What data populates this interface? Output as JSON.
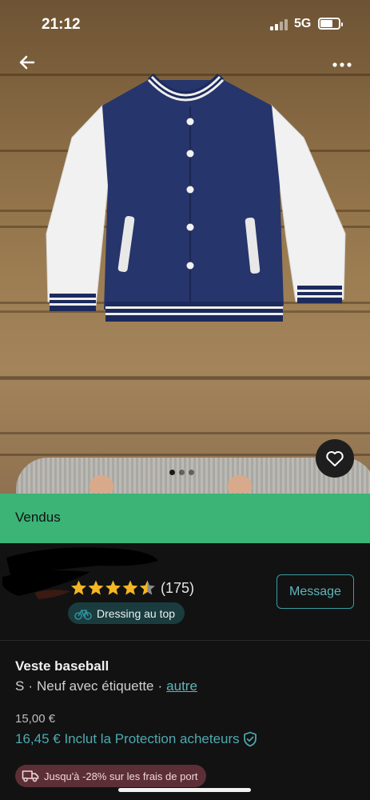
{
  "status_bar": {
    "time": "21:12",
    "network": "5G"
  },
  "listing": {
    "status_label": "Vendus",
    "photo_count": 3,
    "active_photo": 1
  },
  "seller": {
    "rating": 4.5,
    "rating_count": "(175)",
    "badge_label": "Dressing au top",
    "message_label": "Message"
  },
  "item": {
    "title": "Veste baseball",
    "size": "S",
    "separator": "·",
    "condition": "Neuf avec étiquette",
    "brand_link": "autre",
    "price": "15,00 €",
    "price_with_protection": "16,45 € Inclut la Protection acheteurs",
    "shipping_promo": "Jusqu'à -28% sur les frais de port"
  },
  "colors": {
    "sold_green": "#3bb476",
    "accent_teal": "#4eaab2",
    "promo_bg": "#5c2f36",
    "star_gold": "#f5b623"
  },
  "icons": [
    "arrow-left-icon",
    "more-horizontal-icon",
    "heart-icon",
    "star-icon",
    "bicycle-icon",
    "shield-check-icon",
    "truck-icon"
  ]
}
